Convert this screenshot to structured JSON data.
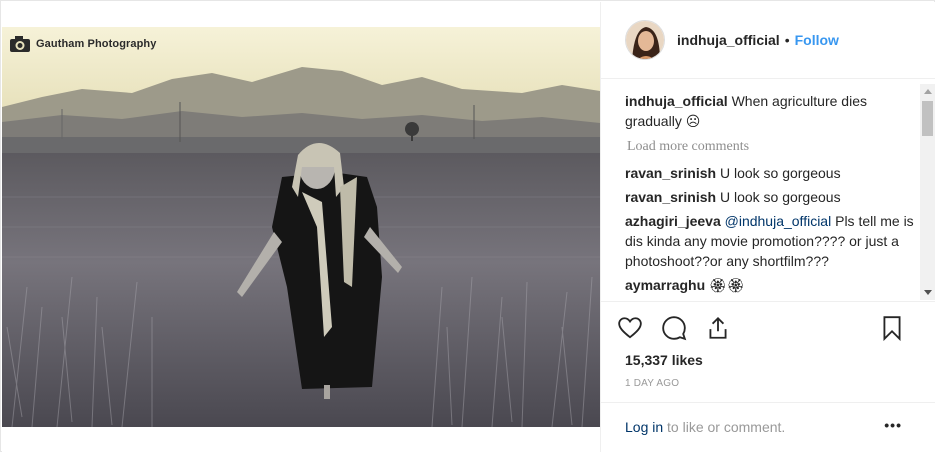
{
  "post": {
    "watermark": "Gautham Photography",
    "username": "indhuja_official",
    "separator": "•",
    "follow_label": "Follow",
    "caption_user": "indhuja_official",
    "caption_text": "When agriculture dies gradually",
    "caption_emoji": "☹",
    "load_more": "Load more comments",
    "comments": [
      {
        "user": "ravan_srinish",
        "text": "U look so gorgeous"
      },
      {
        "user": "ravan_srinish",
        "text": "U look so gorgeous"
      },
      {
        "user": "azhagiri_jeeva",
        "mention": "@indhuja_official",
        "text": "Pls tell me is dis kinda any movie promotion???? or just a photoshoot??or any shortfilm???"
      },
      {
        "user": "aymarraghu",
        "text": "🏵🏵"
      }
    ],
    "likes": "15,337 likes",
    "time": "1 DAY AGO",
    "login_link": "Log in",
    "login_rest": "to like or comment.",
    "more_label": "•••"
  },
  "icons": {
    "like": "heart-icon",
    "comment": "comment-icon",
    "share": "share-icon",
    "save": "bookmark-icon",
    "camera": "camera-icon"
  }
}
